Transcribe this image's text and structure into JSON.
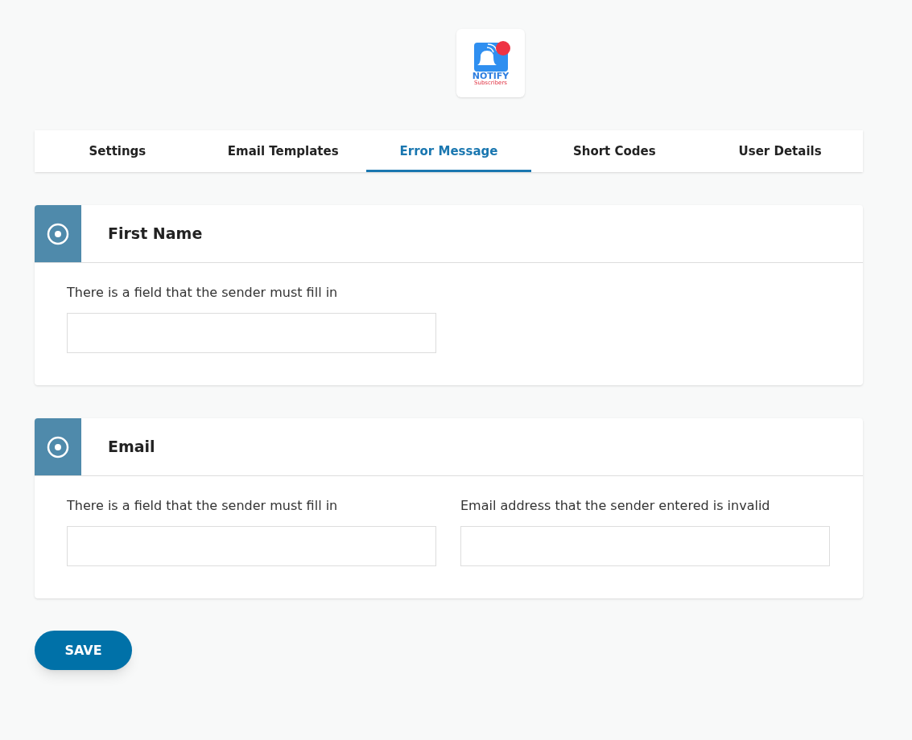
{
  "logo": {
    "title": "NOTIFY",
    "subtitle": "Subscribers"
  },
  "tabs": [
    {
      "label": "Settings",
      "selected": false
    },
    {
      "label": "Email Templates",
      "selected": false
    },
    {
      "label": "Error Message",
      "selected": true
    },
    {
      "label": "Short Codes",
      "selected": false
    },
    {
      "label": "User Details",
      "selected": false
    }
  ],
  "sections": [
    {
      "title": "First Name",
      "fields": [
        {
          "label": "There is a field that the sender must fill in"
        }
      ]
    },
    {
      "title": "Email",
      "fields": [
        {
          "label": "There is a field that the sender must fill in"
        },
        {
          "label": "Email address that the sender entered is invalid"
        }
      ]
    }
  ],
  "save_button": "SAVE"
}
